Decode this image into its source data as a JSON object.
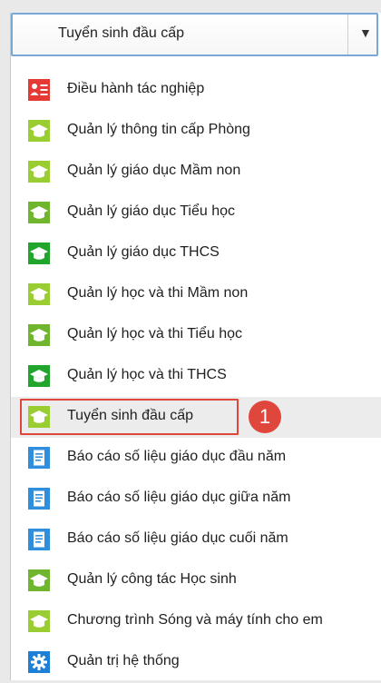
{
  "dropdown": {
    "selected": "Tuyển sinh đầu cấp",
    "caret": "▼"
  },
  "menu": {
    "items": [
      {
        "label": "Điều hành tác nghiệp",
        "icon": "user-list-icon",
        "color": "#e53935"
      },
      {
        "label": "Quản lý thông tin cấp Phòng",
        "icon": "graduation-cap-icon",
        "color": "#9acd32"
      },
      {
        "label": "Quản lý giáo dục Mầm non",
        "icon": "graduation-cap-icon",
        "color": "#9acd32"
      },
      {
        "label": "Quản lý giáo dục Tiểu học",
        "icon": "graduation-cap-icon",
        "color": "#6fb52d"
      },
      {
        "label": "Quản lý giáo dục THCS",
        "icon": "graduation-cap-icon",
        "color": "#22a52d"
      },
      {
        "label": "Quản lý học và thi Mầm non",
        "icon": "graduation-cap-icon",
        "color": "#9acd32"
      },
      {
        "label": "Quản lý học và thi Tiểu học",
        "icon": "graduation-cap-icon",
        "color": "#6fb52d"
      },
      {
        "label": "Quản lý học và thi THCS",
        "icon": "graduation-cap-icon",
        "color": "#22a52d"
      },
      {
        "label": "Tuyển sinh đầu cấp",
        "icon": "graduation-cap-icon",
        "color": "#9acd32"
      },
      {
        "label": "Báo cáo số liệu giáo dục đầu năm",
        "icon": "report-document-icon",
        "color": "#2f8fdc"
      },
      {
        "label": "Báo cáo số liệu giáo dục giữa năm",
        "icon": "report-document-icon",
        "color": "#2f8fdc"
      },
      {
        "label": "Báo cáo số liệu giáo dục cuối năm",
        "icon": "report-document-icon",
        "color": "#2f8fdc"
      },
      {
        "label": "Quản lý công tác Học sinh",
        "icon": "graduation-cap-icon",
        "color": "#6fb52d"
      },
      {
        "label": "Chương trình Sóng và máy tính cho em",
        "icon": "graduation-cap-icon",
        "color": "#9acd32"
      },
      {
        "label": "Quản trị hệ thống",
        "icon": "gear-icon",
        "color": "#1e7fd6"
      }
    ]
  },
  "annotation": {
    "step_number": "1",
    "color": "#e0473c"
  }
}
